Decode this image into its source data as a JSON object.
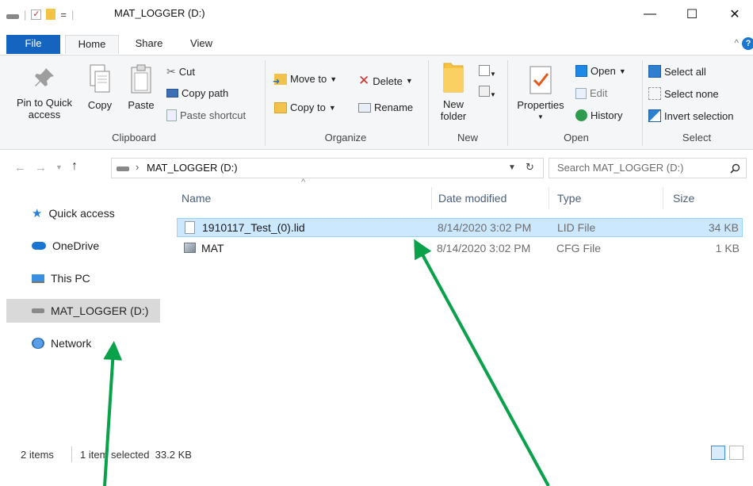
{
  "window": {
    "title": "MAT_LOGGER (D:)",
    "qat_dropdown": "=",
    "minimize": "—",
    "maximize": "☐",
    "close": "✕"
  },
  "tabs": [
    {
      "label": "File"
    },
    {
      "label": "Home"
    },
    {
      "label": "Share"
    },
    {
      "label": "View"
    }
  ],
  "ribbon": {
    "clipboard": {
      "label": "Clipboard",
      "pin_label_1": "Pin to Quick",
      "pin_label_2": "access",
      "copy": "Copy",
      "paste": "Paste",
      "cut": "Cut",
      "copy_path": "Copy path",
      "paste_shortcut": "Paste shortcut"
    },
    "organize": {
      "label": "Organize",
      "move_to": "Move to",
      "copy_to": "Copy to",
      "delete": "Delete",
      "rename": "Rename"
    },
    "new": {
      "label": "New",
      "new_folder_1": "New",
      "new_folder_2": "folder"
    },
    "open": {
      "label": "Open",
      "properties": "Properties",
      "open": "Open",
      "edit": "Edit",
      "history": "History"
    },
    "select": {
      "label": "Select",
      "select_all": "Select all",
      "select_none": "Select none",
      "invert_selection": "Invert selection"
    }
  },
  "address": {
    "path_sep": "›",
    "location": "MAT_LOGGER (D:)",
    "search_placeholder": "Search MAT_LOGGER (D:)"
  },
  "nav": [
    {
      "label": "Quick access"
    },
    {
      "label": "OneDrive"
    },
    {
      "label": "This PC"
    },
    {
      "label": "MAT_LOGGER (D:)"
    },
    {
      "label": "Network"
    }
  ],
  "columns": {
    "name": "Name",
    "date_modified": "Date modified",
    "type": "Type",
    "size": "Size"
  },
  "files": [
    {
      "name": "1910117_Test_(0).lid",
      "date": "8/14/2020 3:02 PM",
      "type": "LID File",
      "size": "34 KB"
    },
    {
      "name": "MAT",
      "date": "8/14/2020 3:02 PM",
      "type": "CFG File",
      "size": "1 KB"
    }
  ],
  "status": {
    "item_count": "2 items",
    "selection": "1 item selected  33.2 KB"
  },
  "colors": {
    "file_tab": "#1565c0",
    "selection_fill": "#cce8ff",
    "selection_border": "#99d1ff",
    "nav_selected": "#d9d9d9",
    "annotation_arrow": "#0aa14b"
  }
}
